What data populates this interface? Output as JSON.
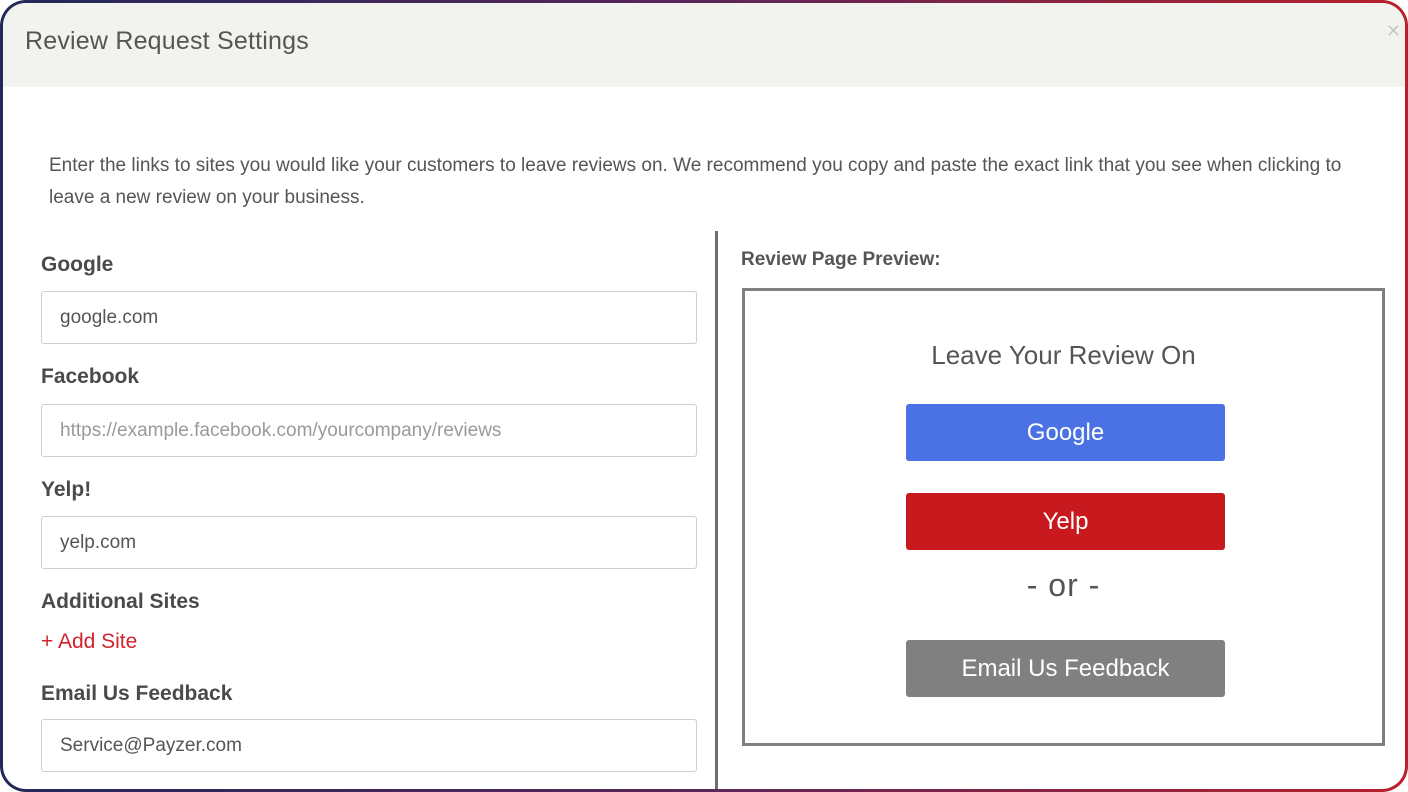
{
  "modal": {
    "title": "Review Request Settings",
    "close_icon": "close-icon",
    "intro": "Enter the links to sites you would like your customers to leave reviews on. We recommend you copy and paste the exact link that you see when clicking to leave a new review on your business."
  },
  "form": {
    "google": {
      "label": "Google",
      "value": "google.com",
      "placeholder": ""
    },
    "facebook": {
      "label": "Facebook",
      "value": "",
      "placeholder": "https://example.facebook.com/yourcompany/reviews"
    },
    "yelp": {
      "label": "Yelp!",
      "value": "yelp.com",
      "placeholder": ""
    },
    "additional": {
      "label": "Additional Sites",
      "add_link": "+ Add Site"
    },
    "email": {
      "label": "Email Us Feedback",
      "value": "Service@Payzer.com",
      "placeholder": ""
    }
  },
  "preview": {
    "label": "Review Page Preview:",
    "heading": "Leave Your Review On",
    "google_button": "Google",
    "yelp_button": "Yelp",
    "or_text": "- or -",
    "email_button": "Email Us Feedback"
  },
  "colors": {
    "google": "#4a72e4",
    "yelp": "#c8191e",
    "email": "#808080",
    "accent": "#d0232c"
  }
}
